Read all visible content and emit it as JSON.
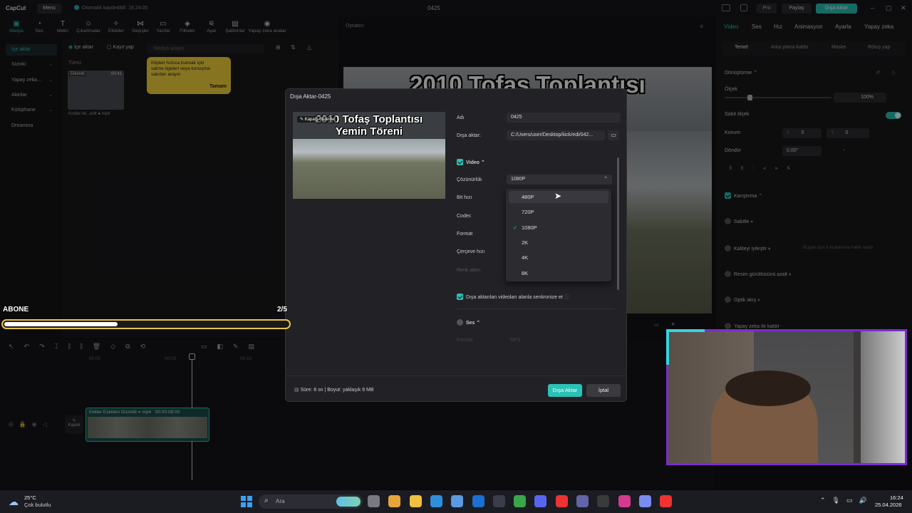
{
  "app": {
    "logo": "CapCut",
    "menu_label": "Menü",
    "save_status": "Otomatik kaydedildi: 16:24:05",
    "project_title": "0425",
    "pro_label": "Pro",
    "share_label": "Paylaş",
    "export_label": "Dışa Aktar"
  },
  "tools": [
    {
      "label": "Medya",
      "icon": "▣"
    },
    {
      "label": "Ses",
      "icon": "◔"
    },
    {
      "label": "Metin",
      "icon": "T"
    },
    {
      "label": "Çıkartmalar",
      "icon": "☺"
    },
    {
      "label": "Efektler",
      "icon": "✧"
    },
    {
      "label": "Geçişler",
      "icon": "⋈"
    },
    {
      "label": "Yazılar",
      "icon": "▭"
    },
    {
      "label": "Filtreler",
      "icon": "◈"
    },
    {
      "label": "Ayar",
      "icon": "⚟"
    },
    {
      "label": "Şablonlar",
      "icon": "▤"
    },
    {
      "label": "Yapay zeka avatar",
      "icon": "◉"
    }
  ],
  "leftnav": [
    {
      "label": "İçe aktar"
    },
    {
      "label": "Sizinki"
    },
    {
      "label": "Yapay zeka..."
    },
    {
      "label": "Alanlar"
    },
    {
      "label": "Kütüphane"
    },
    {
      "label": "Dreamina"
    }
  ],
  "media": {
    "import_btn": "İçe aktar",
    "record_btn": "Kayıt yap",
    "search_placeholder": "Medya arayın",
    "all_label": "Tümü",
    "clip_badge": "Eklendi",
    "clip_duration": "00:41",
    "clip_name": "Kodlar ile...edit",
    "clip_ext": "mp4"
  },
  "tooltip": {
    "text": "Klipleri hızlıca bulmak için sahne ögeleri veya konuşma satırları arayın",
    "button": "Tamam"
  },
  "player": {
    "label": "Oynatıcı",
    "title": "2010 Tofaş Toplantısı"
  },
  "rightpanel": {
    "tabs": [
      "Video",
      "Ses",
      "Hız",
      "Animasyon",
      "Ayarla",
      "Yapay zeka"
    ],
    "subtabs": [
      "Temel",
      "Arka plana kaldır",
      "Maske",
      "Rötuş yap"
    ],
    "transform": "Dönüştürme",
    "scale": "Ölçek",
    "scale_value": "100%",
    "uniform_scale": "Sabit ölçek",
    "position": "Konum",
    "pos_x_label": "X",
    "pos_x": "0",
    "pos_y_label": "Y",
    "pos_y": "0",
    "rotate": "Döndür",
    "rotate_value": "0.00°",
    "rotate_dash": "-",
    "blend": "Karıştırma",
    "stabilize": "Sabitle",
    "enhance": "Kaliteyi iyileştir",
    "enhance_note": "Bugün için 3 kullanıma hakkı kaldı",
    "denoise": "Resim gürültüsünü azalt",
    "optical_flow": "Optik akış",
    "ai_remove": "Yapay zeka ile kaldır"
  },
  "timeline": {
    "marks": [
      "00:00",
      "00:05",
      "00:10"
    ],
    "clip_label": "Ekkler Eskiden Güzeldi",
    "clip_ext": "mp4",
    "clip_time": "00:00:08:00",
    "cover": "Kapak"
  },
  "abone": {
    "label": "ABONE",
    "count": "2/5",
    "progress": 0.4
  },
  "dialog": {
    "title": "Dışa Aktar-0425",
    "thumb_title_line1": "2010 Tofaş Toplantısı",
    "thumb_title_line2": "Yemin Töreni",
    "edit_cover": "Kapağı düzenle",
    "name_label": "Adı",
    "name_value": "0425",
    "export_to_label": "Dışa aktar:",
    "export_to_value": "C:/Users/user/Desktop/kick/edi/042...",
    "video_section": "Video",
    "resolution_label": "Çözünürlük",
    "resolution_value": "1080P",
    "bitrate_label": "Bit hızı",
    "codec_label": "Codec",
    "format_label": "Format",
    "framerate_label": "Çerçeve hızı",
    "color_label": "Renk alanı",
    "sync_label": "Dışa aktarılan videoları alanla senkronize et",
    "audio_section": "Ses",
    "audio_format_label": "Format",
    "audio_format_value": "MP3",
    "footer_info": "Süre: 8 sn | Boyut: yaklaşık 8 MB",
    "export_btn": "Dışa Aktar",
    "cancel_btn": "İptal"
  },
  "resolution_options": [
    "480P",
    "720P",
    "1080P",
    "2K",
    "4K",
    "8K"
  ],
  "resolution_selected": "1080P",
  "taskbar": {
    "weather_temp": "25°C",
    "weather_desc": "Çok bulutlu",
    "search_placeholder": "Ara",
    "time": "16:24",
    "date": "25.04.2026"
  },
  "colors": {
    "accent": "#2bc1b6",
    "tooltip": "#f5d33d",
    "webcam_border": "#7b2bd1",
    "abone_border": "#e6c24a"
  }
}
